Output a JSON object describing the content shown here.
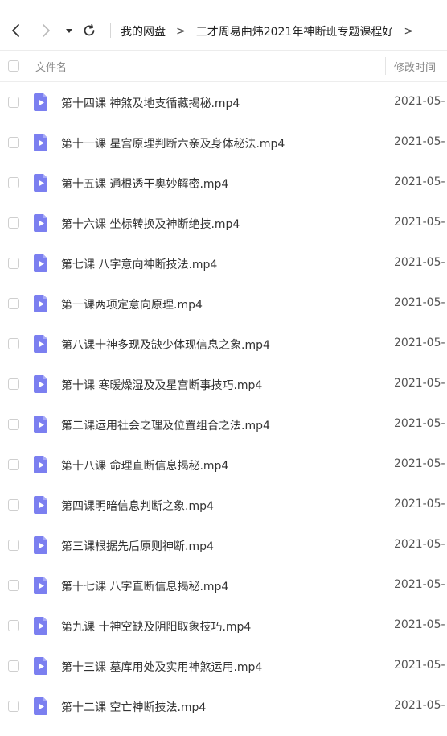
{
  "toolbar": {
    "breadcrumb": [
      {
        "label": "我的网盘"
      },
      {
        "label": "三才周易曲炜2021年神断班专题课程好"
      }
    ],
    "separator": ">"
  },
  "header": {
    "name_label": "文件名",
    "time_label": "修改时间"
  },
  "files": [
    {
      "name": "第十四课 神煞及地支循藏揭秘.mp4",
      "time": "2021-05-"
    },
    {
      "name": "第十一课 星宫原理判断六亲及身体秘法.mp4",
      "time": "2021-05-"
    },
    {
      "name": "第十五课 通根透干奥妙解密.mp4",
      "time": "2021-05-"
    },
    {
      "name": "第十六课 坐标转换及神断绝技.mp4",
      "time": "2021-05-"
    },
    {
      "name": "第七课 八字意向神断技法.mp4",
      "time": "2021-05-"
    },
    {
      "name": "第一课两项定意向原理.mp4",
      "time": "2021-05-"
    },
    {
      "name": "第八课十神多现及缺少体现信息之象.mp4",
      "time": "2021-05-"
    },
    {
      "name": "第十课 寒暖燥湿及及星宫断事技巧.mp4",
      "time": "2021-05-"
    },
    {
      "name": "第二课运用社会之理及位置组合之法.mp4",
      "time": "2021-05-"
    },
    {
      "name": "第十八课 命理直断信息揭秘.mp4",
      "time": "2021-05-"
    },
    {
      "name": "第四课明暗信息判断之象.mp4",
      "time": "2021-05-"
    },
    {
      "name": "第三课根据先后原则神断.mp4",
      "time": "2021-05-"
    },
    {
      "name": "第十七课 八字直断信息揭秘.mp4",
      "time": "2021-05-"
    },
    {
      "name": "第九课 十神空缺及阴阳取象技巧.mp4",
      "time": "2021-05-"
    },
    {
      "name": "第十三课 墓库用处及实用神煞运用.mp4",
      "time": "2021-05-"
    },
    {
      "name": "第十二课 空亡神断技法.mp4",
      "time": "2021-05-"
    }
  ],
  "colors": {
    "file_icon": "#7b7ff0",
    "file_icon_fold": "#a9acf7"
  }
}
